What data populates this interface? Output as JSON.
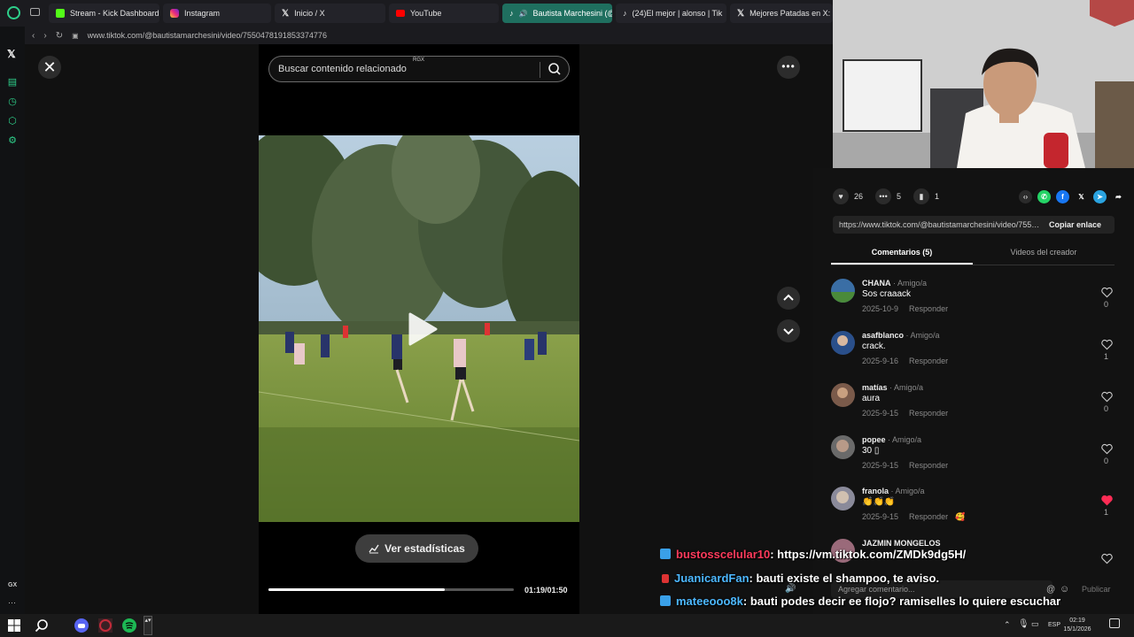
{
  "browser": {
    "tabs": [
      {
        "label": "Stream - Kick Dashboard",
        "icon": "kick-icon",
        "color": "#53fc18"
      },
      {
        "label": "Instagram",
        "icon": "instagram-icon",
        "color": "#e1306c"
      },
      {
        "label": "Inicio / X",
        "icon": "x-icon",
        "color": "#ffffff"
      },
      {
        "label": "YouTube",
        "icon": "youtube-icon",
        "color": "#ff0000"
      },
      {
        "label": "Bautista Marchesini (@",
        "icon": "tiktok-icon",
        "color": "#ffffff"
      },
      {
        "label": "(24)El mejor | alonso | Tik",
        "icon": "tiktok-icon",
        "color": "#ffffff"
      },
      {
        "label": "Mejores Patadas en X: \"E",
        "icon": "x-icon",
        "color": "#ffffff"
      }
    ],
    "url": "www.tiktok.com/@bautistamarchesini/video/7550478191853374776"
  },
  "video": {
    "search_placeholder": "Buscar contenido relacionado",
    "search_badge": "RGX",
    "stats_label": "Ver estadísticas",
    "time": "01:19/01:50",
    "progress": 0.72
  },
  "actions": {
    "likes": "26",
    "comments": "5",
    "saves": "1"
  },
  "share": {
    "url": "https://www.tiktok.com/@bautistamarchesini/video/7550478191853374776",
    "copy_label": "Copiar enlace"
  },
  "comment_tabs": {
    "comments": "Comentarios (5)",
    "creator_videos": "Videos del creador"
  },
  "comments": [
    {
      "author": "CHANA",
      "rel": " · Amigo/a",
      "text": "Sos craaack",
      "date": "2025-10-9",
      "reply": "Responder",
      "likes": "0",
      "liked": false,
      "avatar": "#3a6ea5"
    },
    {
      "author": "asafblanco",
      "rel": " · Amigo/a",
      "text": "crack.",
      "date": "2025-9-16",
      "reply": "Responder",
      "likes": "1",
      "liked": false,
      "avatar": "#2a4f8a"
    },
    {
      "author": "matías",
      "rel": " · Amigo/a",
      "text": "aura",
      "date": "2025-9-15",
      "reply": "Responder",
      "likes": "0",
      "liked": false,
      "avatar": "#7a5a4a"
    },
    {
      "author": "popee",
      "rel": " · Amigo/a",
      "text": "30 ▯",
      "date": "2025-9-15",
      "reply": "Responder",
      "likes": "0",
      "liked": false,
      "avatar": "#6a6a6a"
    },
    {
      "author": "franola",
      "rel": " · Amigo/a",
      "text": "👏👏👏",
      "date": "2025-9-15",
      "reply": "Responder",
      "likes": "1",
      "liked": true,
      "avatar": "#8a8a9a"
    },
    {
      "author": "JAZMIN MONGELOS",
      "rel": "",
      "text": "",
      "date": "",
      "reply": "",
      "likes": "",
      "liked": false,
      "avatar": "#9a6a7a"
    }
  ],
  "comment_input": {
    "placeholder": "Agregar comentario...",
    "publish": "Publicar"
  },
  "chat": [
    {
      "user": "bustosscelular10",
      "msg": ": https://vm.tiktok.com/ZMDk9dg5H/",
      "user_color": "#ff3b5c",
      "badge": "#3aa0e8"
    },
    {
      "user": "JuanicardFan",
      "msg": ": bauti existe el shampoo, te aviso.",
      "user_color": "#4db8ff",
      "badge": "#d33"
    },
    {
      "user": "mateeooo8k",
      "msg": ": bauti podes decir ee flojo? ramiselles lo quiere escuchar",
      "user_color": "#4db8ff",
      "badge": "#3aa0e8"
    }
  ],
  "taskbar": {
    "time": "02:19",
    "date": "15/1/2026",
    "lang": "ESP"
  },
  "opera_sidebar_label": "GX"
}
